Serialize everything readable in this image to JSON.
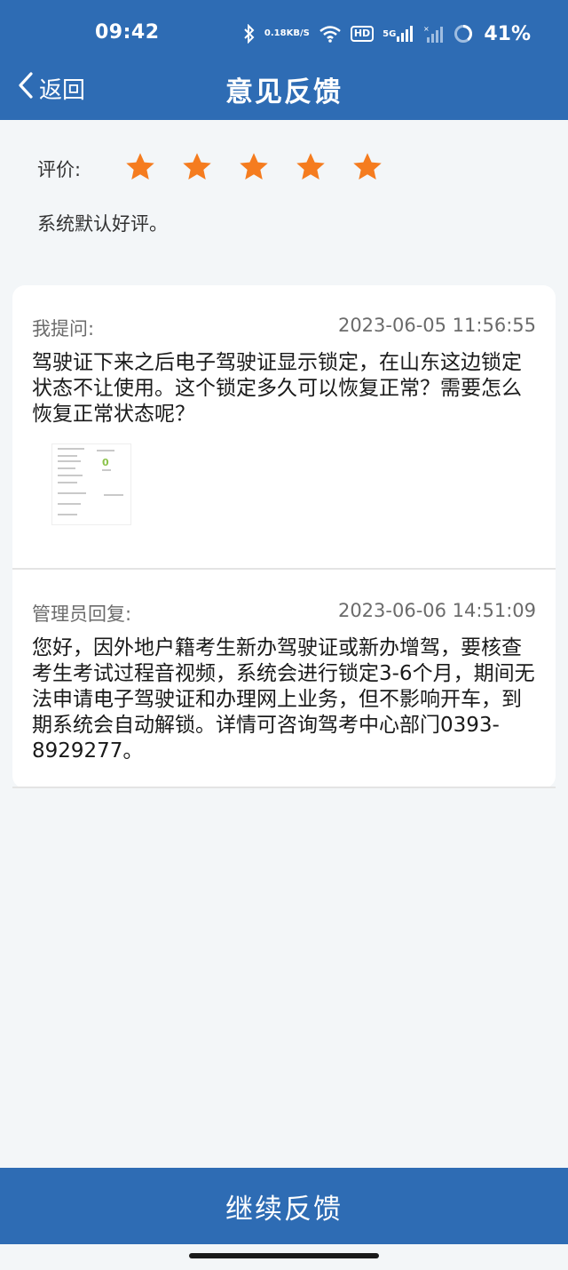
{
  "status_bar": {
    "time": "09:42",
    "net_speed_value": "0.18",
    "net_speed_unit": "KB/S",
    "hd_label": "HD",
    "sim_label": "5G",
    "battery": "41%"
  },
  "nav": {
    "back_label": "返回",
    "title": "意见反馈"
  },
  "rating": {
    "label": "评价:",
    "stars": 5,
    "max_stars": 5,
    "star_color": "#f57c1f",
    "note": "系统默认好评。"
  },
  "question": {
    "label": "我提问:",
    "time": "2023-06-05 11:56:55",
    "text": "驾驶证下来之后电子驾驶证显示锁定，在山东这边锁定状态不让使用。这个锁定多久可以恢复正常？需要怎么恢复正常状态呢？",
    "thumb_value": "0"
  },
  "reply": {
    "label": "管理员回复:",
    "time": "2023-06-06 14:51:09",
    "text": "您好，因外地户籍考生新办驾驶证或新办增驾，要核查考生考试过程音视频，系统会进行锁定3-6个月，期间无法申请电子驾驶证和办理网上业务，但不影响开车，到期系统会自动解锁。详情可咨询驾考中心部门0393-8929277。"
  },
  "footer": {
    "continue_label": "继续反馈"
  },
  "colors": {
    "primary": "#2e6cb4",
    "accent": "#f57c1f",
    "background": "#f3f6f8"
  }
}
